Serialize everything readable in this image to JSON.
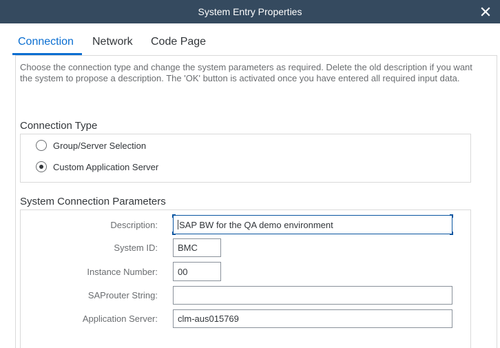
{
  "window": {
    "title": "System Entry Properties",
    "close_icon": "close-icon"
  },
  "tabs": [
    {
      "label": "Connection",
      "active": true
    },
    {
      "label": "Network",
      "active": false
    },
    {
      "label": "Code Page",
      "active": false
    }
  ],
  "intro_text": "Choose the connection type and change the system parameters as required. Delete the old description if you want the system to propose a description. The 'OK' button is activated once you have entered all required input data.",
  "connection_type": {
    "title": "Connection Type",
    "options": [
      {
        "label": "Group/Server Selection",
        "selected": false
      },
      {
        "label": "Custom Application Server",
        "selected": true
      }
    ]
  },
  "system_connection": {
    "title": "System Connection Parameters",
    "description_label": "Description:",
    "description_value": "SAP BW for the QA demo environment",
    "system_id_label": "System ID:",
    "system_id_value": "BMC",
    "instance_number_label": "Instance Number:",
    "instance_number_value": "00",
    "saprouter_label": "SAProuter String:",
    "saprouter_value": "",
    "app_server_label": "Application Server:",
    "app_server_value": "clm-aus015769"
  },
  "colors": {
    "titlebar": "#354a5f",
    "accent": "#0a6ed1",
    "text": "#32363a",
    "label": "#6a6d70"
  }
}
